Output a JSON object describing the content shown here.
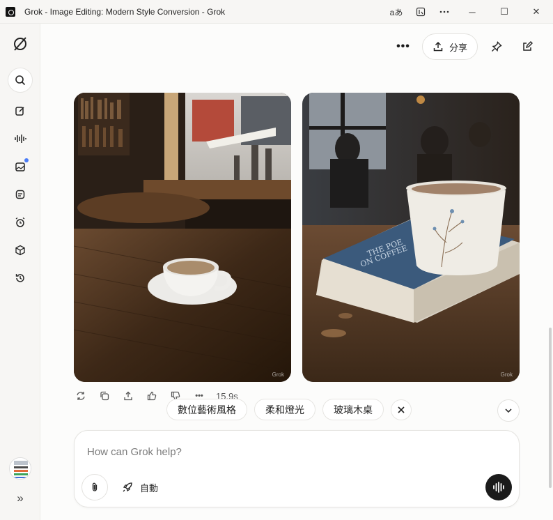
{
  "window": {
    "title": "Grok - Image Editing: Modern Style Conversion - Grok",
    "controls": {
      "translate": "aあ",
      "minimize": "─",
      "maximize": "☐",
      "close": "✕"
    }
  },
  "sidebar": {
    "items": [
      {
        "name": "logo",
        "icon": "grok-logo-icon"
      },
      {
        "name": "search",
        "icon": "search-icon"
      },
      {
        "name": "new-chat",
        "icon": "edit-icon"
      },
      {
        "name": "voice",
        "icon": "waveform-icon"
      },
      {
        "name": "imagine",
        "icon": "image-icon",
        "badge": true
      },
      {
        "name": "files",
        "icon": "note-icon"
      },
      {
        "name": "tasks",
        "icon": "alarm-icon"
      },
      {
        "name": "projects",
        "icon": "cube-icon"
      },
      {
        "name": "history",
        "icon": "history-icon"
      }
    ],
    "expand": "»"
  },
  "header": {
    "more": "•••",
    "share_label": "分享"
  },
  "images": [
    {
      "alt": "coffee cup on wooden table by café window",
      "watermark": "Grok"
    },
    {
      "alt": "coffee cup on blue book in café",
      "watermark": "Grok"
    }
  ],
  "message_actions": {
    "more": "•••",
    "duration": "15.9s"
  },
  "suggestions": [
    "數位藝術風格",
    "柔和燈光",
    "玻璃木桌"
  ],
  "composer": {
    "placeholder": "How can Grok help?",
    "mode_label": "自動"
  },
  "colors": {
    "accent_badge": "#4a7cf7",
    "voice_button": "#1b1b1b"
  }
}
